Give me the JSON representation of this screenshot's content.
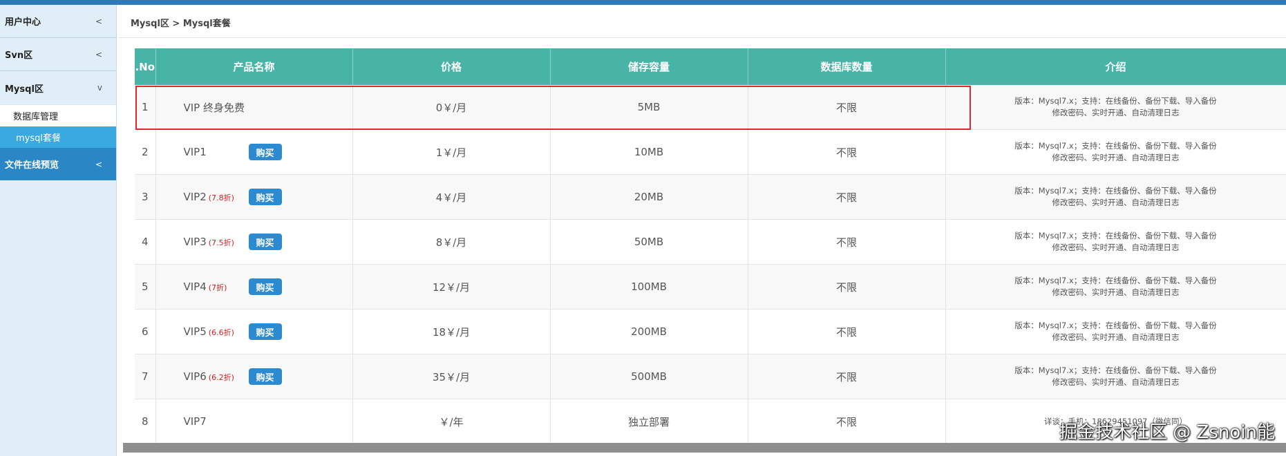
{
  "sidebar": {
    "groups": [
      {
        "label": "用户中心",
        "chevron": "<"
      },
      {
        "label": "Svn区",
        "chevron": "<"
      },
      {
        "label": "Mysql区",
        "chevron": "v"
      }
    ],
    "sub_items": [
      {
        "label": "数据库管理"
      },
      {
        "label": "mysql套餐"
      }
    ],
    "file_preview": {
      "label": "文件在线预览",
      "chevron": "<"
    }
  },
  "breadcrumb": "Mysql区 > Mysql套餐",
  "table": {
    "headers": [
      ".No",
      "产品名称",
      "价格",
      "储存容量",
      "数据库数量",
      "介绍"
    ],
    "buy_label": "购买",
    "intro_line1": "版本：Mysql7.x；支持：在线备份、备份下载、导入备份",
    "intro_line2": "修改密码、实时开通、自动清理日志",
    "rows": [
      {
        "no": "1",
        "name": "VIP 终身免费",
        "discount": "",
        "price": "0￥/月",
        "storage": "5MB",
        "count": "不限"
      },
      {
        "no": "2",
        "name": "VIP1",
        "discount": "",
        "price": "1￥/月",
        "storage": "10MB",
        "count": "不限"
      },
      {
        "no": "3",
        "name": "VIP2",
        "discount": "(7.8折)",
        "price": "4￥/月",
        "storage": "20MB",
        "count": "不限"
      },
      {
        "no": "4",
        "name": "VIP3",
        "discount": "(7.5折)",
        "price": "8￥/月",
        "storage": "50MB",
        "count": "不限"
      },
      {
        "no": "5",
        "name": "VIP4",
        "discount": "(7折)",
        "price": "12￥/月",
        "storage": "100MB",
        "count": "不限"
      },
      {
        "no": "6",
        "name": "VIP5",
        "discount": "(6.6折)",
        "price": "18￥/月",
        "storage": "200MB",
        "count": "不限"
      },
      {
        "no": "7",
        "name": "VIP6",
        "discount": "(6.2折)",
        "price": "35￥/月",
        "storage": "500MB",
        "count": "不限"
      },
      {
        "no": "8",
        "name": "VIP7",
        "discount": "",
        "price": "￥/年",
        "storage": "独立部署",
        "count": "不限",
        "intro": "详谈；手机：18629451097（微信同）"
      }
    ]
  },
  "watermark": "掘金技术社区 @ Zsnoin能",
  "colors": {
    "header": "#48b3a7",
    "sidebar_active": "#2b86c5",
    "sub_active": "#39a9e0",
    "buy_button": "#2c8bd0",
    "discount": "#cc1f1f",
    "highlight_box": "#d92b2b"
  }
}
